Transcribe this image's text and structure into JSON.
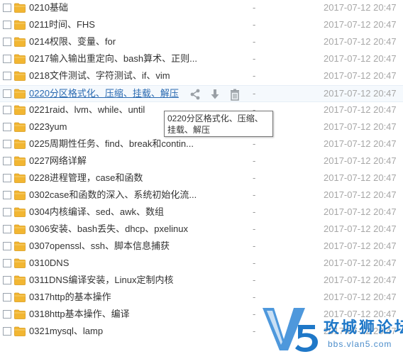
{
  "files": [
    {
      "name": "0210基础",
      "size": "-",
      "date": "2017-07-12 20:47"
    },
    {
      "name": "0211时间、FHS",
      "size": "-",
      "date": "2017-07-12 20:47"
    },
    {
      "name": "0214权限、变量、for",
      "size": "-",
      "date": "2017-07-12 20:47"
    },
    {
      "name": "0217输入输出重定向、bash算术、正则...",
      "size": "-",
      "date": "2017-07-12 20:47"
    },
    {
      "name": "0218文件测试、字符测试、if、vim",
      "size": "-",
      "date": "2017-07-12 20:47"
    },
    {
      "name": "0220分区格式化、压缩、挂载、解压",
      "size": "-",
      "date": "2017-07-12 20:47"
    },
    {
      "name": "0221raid、lvm、while、until",
      "size": "-",
      "date": "2017-07-12 20:47"
    },
    {
      "name": "0223yum",
      "size": "-",
      "date": "2017-07-12 20:47"
    },
    {
      "name": "0225周期性任务、find、break和contin...",
      "size": "-",
      "date": "2017-07-12 20:47"
    },
    {
      "name": "0227网络详解",
      "size": "-",
      "date": "2017-07-12 20:47"
    },
    {
      "name": "0228进程管理，case和函数",
      "size": "-",
      "date": "2017-07-12 20:47"
    },
    {
      "name": "0302case和函数的深入、系统初始化流...",
      "size": "-",
      "date": "2017-07-12 20:47"
    },
    {
      "name": "0304内核编译、sed、awk、数组",
      "size": "-",
      "date": "2017-07-12 20:47"
    },
    {
      "name": "0306安装、bash丢失、dhcp、pxelinux",
      "size": "-",
      "date": "2017-07-12 20:47"
    },
    {
      "name": "0307openssl、ssh、脚本信息捕获",
      "size": "-",
      "date": "2017-07-12 20:47"
    },
    {
      "name": "0310DNS",
      "size": "-",
      "date": "2017-07-12 20:47"
    },
    {
      "name": "0311DNS编译安装，Linux定制内核",
      "size": "-",
      "date": "2017-07-12 20:47"
    },
    {
      "name": "0317http的基本操作",
      "size": "-",
      "date": "2017-07-12 20:47"
    },
    {
      "name": "0318http基本操作、编译",
      "size": "-",
      "date": "2017-07-12 20:47"
    },
    {
      "name": "0321mysql、lamp",
      "size": "-",
      "date": "2017-07-12 20:47"
    }
  ],
  "hover_index": 5,
  "row_actions": [
    "share-icon",
    "download-icon",
    "delete-icon"
  ],
  "tooltip": {
    "text": "0220分区格式化、压缩、挂载、解压"
  },
  "watermark": {
    "title": "攻城狮论坛",
    "url": "bbs.vlan5.com"
  },
  "colors": {
    "folder": "#f2b632",
    "hover_row": "#f5f9fd",
    "link_hover": "#2a6ab1",
    "watermark": "#1f78c8"
  }
}
